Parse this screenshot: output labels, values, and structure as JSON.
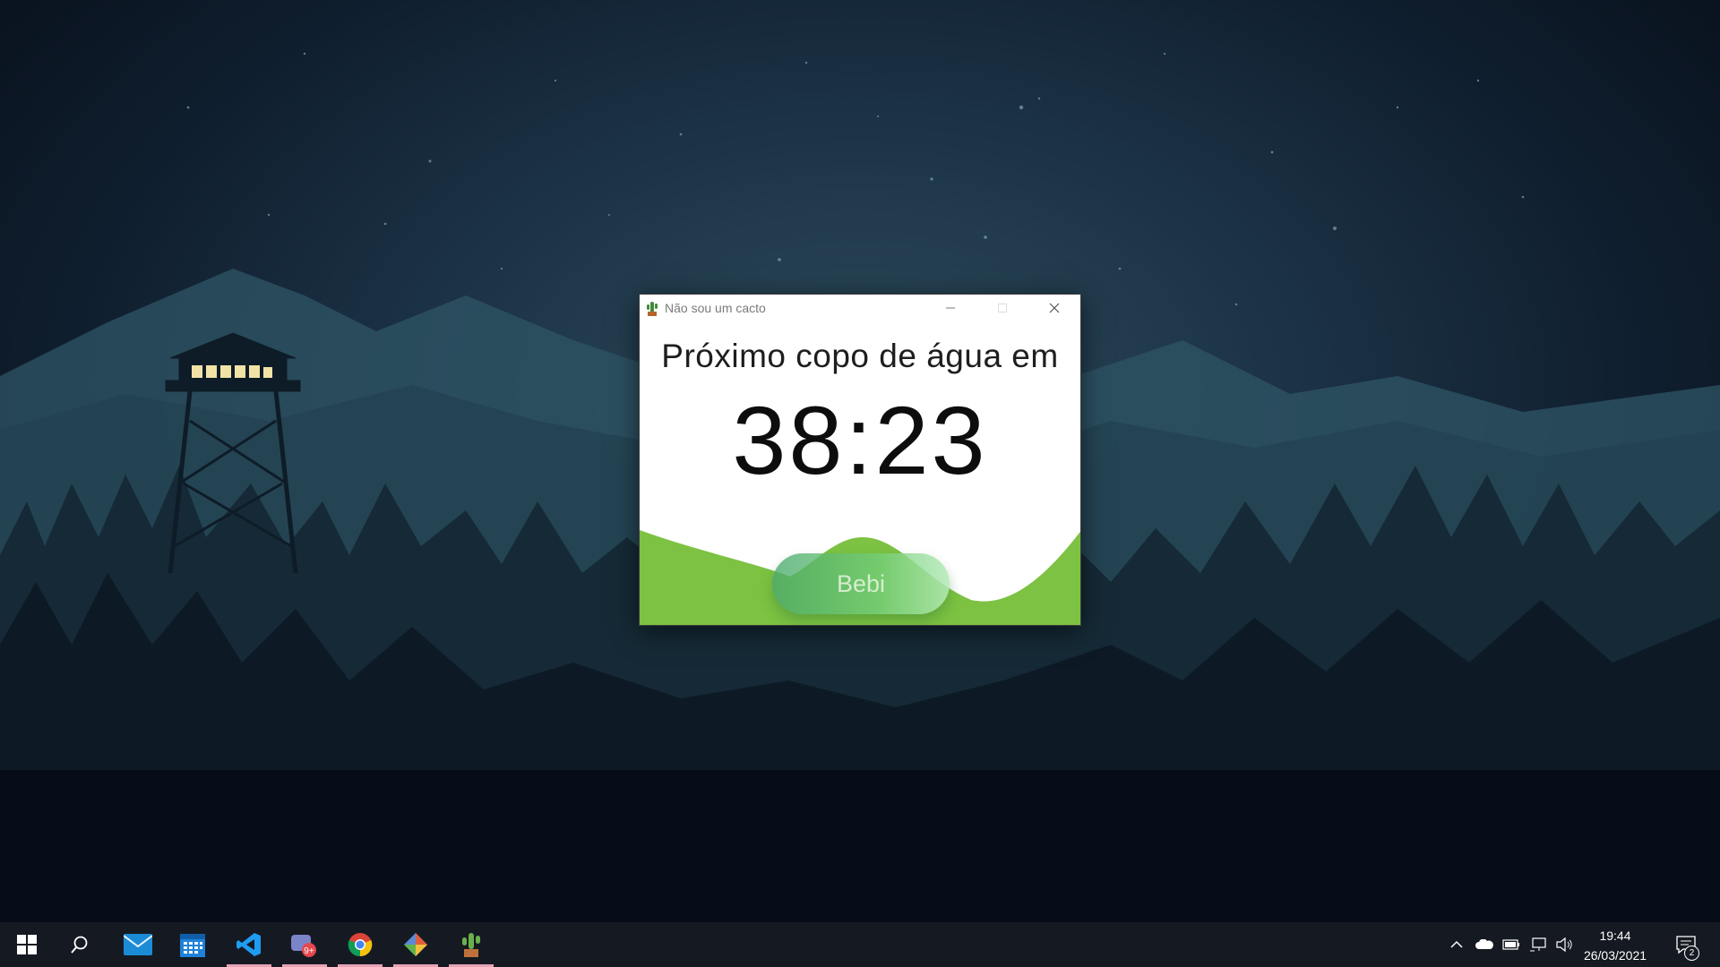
{
  "window": {
    "title": "Não sou um cacto",
    "heading": "Próximo copo de água em",
    "timer": "38:23",
    "button_label": "Bebi",
    "wave_color": "#7dc242"
  },
  "taskbar": {
    "pinned": [
      {
        "name": "start-button",
        "icon": "windows-logo"
      },
      {
        "name": "search-button",
        "icon": "search-icon"
      },
      {
        "name": "mail",
        "icon": "mail-icon"
      },
      {
        "name": "calendar",
        "icon": "calendar-icon"
      },
      {
        "name": "vscode",
        "icon": "vscode-icon",
        "running": true
      },
      {
        "name": "teams-like-app",
        "icon": "chat-badge-icon",
        "badge": "9+",
        "running": true
      },
      {
        "name": "chrome",
        "icon": "chrome-icon",
        "running": true
      },
      {
        "name": "git-app",
        "icon": "git-icon",
        "running": true
      },
      {
        "name": "cactus-app",
        "icon": "cactus-icon",
        "running": true
      }
    ],
    "clock_time": "19:44",
    "clock_date": "26/03/2021",
    "notification_count": "2",
    "running_indicator_color": "#e6a3b6"
  }
}
